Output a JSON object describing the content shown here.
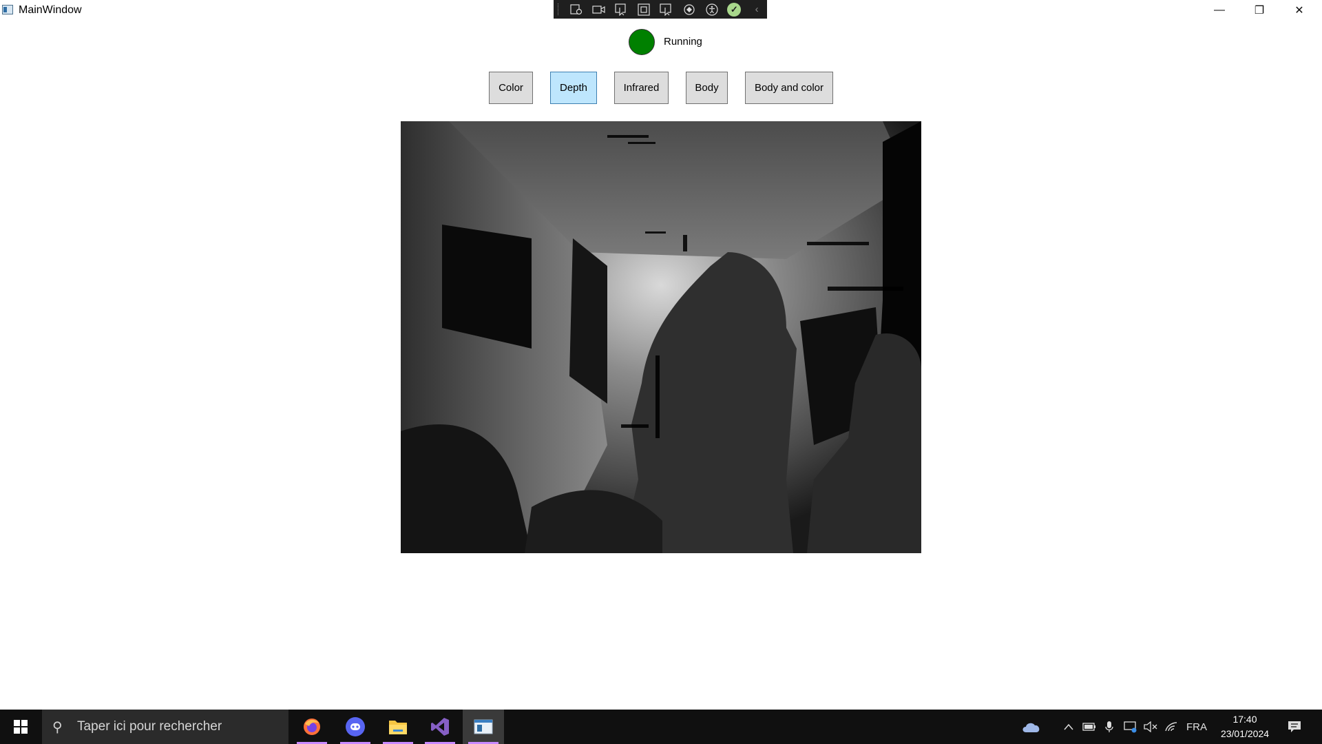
{
  "window": {
    "title": "MainWindow",
    "controls": {
      "minimize": "—",
      "restore": "❐",
      "close": "✕"
    }
  },
  "debug_toolbar": {
    "icons": [
      "live-visual-tree-icon",
      "record-icon",
      "select-element-icon",
      "display-layout-adorners-icon",
      "track-focus-icon",
      "hot-reload-icon",
      "accessibility-icon",
      "binding-check-icon",
      "collapse-icon"
    ]
  },
  "status": {
    "indicator_color": "#008000",
    "label": "Running"
  },
  "mode_buttons": [
    {
      "label": "Color",
      "active": false
    },
    {
      "label": "Depth",
      "active": true
    },
    {
      "label": "Infrared",
      "active": false
    },
    {
      "label": "Body",
      "active": false
    },
    {
      "label": "Body and color",
      "active": false
    }
  ],
  "taskbar": {
    "search_placeholder": "Taper ici pour rechercher",
    "apps": [
      "firefox-icon",
      "discord-icon",
      "file-explorer-icon",
      "visual-studio-icon",
      "wpf-app-icon"
    ],
    "tray": {
      "language": "FRA",
      "time": "17:40",
      "date": "23/01/2024"
    }
  }
}
